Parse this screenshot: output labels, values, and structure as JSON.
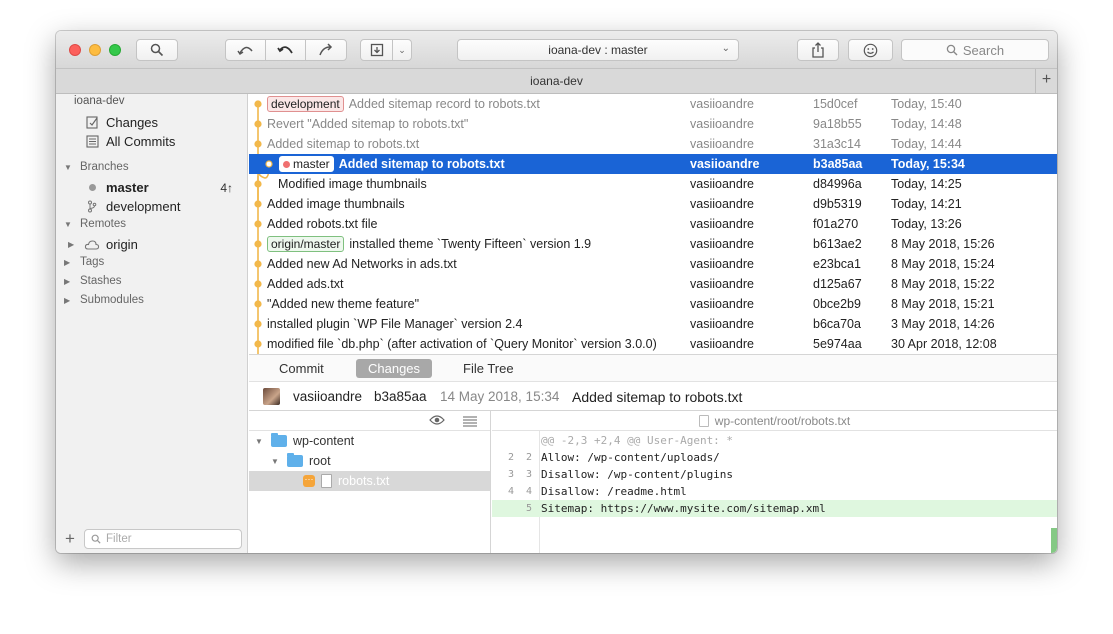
{
  "titlebar": {
    "repo_branch": "ioana-dev :  master",
    "search_placeholder": "Search"
  },
  "tabbar": {
    "title": "ioana-dev"
  },
  "sidebar": {
    "repo_name": "ioana-dev",
    "workspace": [
      {
        "label": "Changes",
        "icon": "changes-icon"
      },
      {
        "label": "All Commits",
        "icon": "all-commits-icon"
      }
    ],
    "branches_header": "Branches",
    "branches": [
      {
        "label": "master",
        "count": "4↑",
        "current": true
      },
      {
        "label": "development",
        "count": "",
        "current": false
      }
    ],
    "remotes_header": "Remotes",
    "remotes": [
      {
        "label": "origin"
      }
    ],
    "tags_header": "Tags",
    "stashes_header": "Stashes",
    "submodules_header": "Submodules",
    "filter_placeholder": "Filter"
  },
  "commits": [
    {
      "tag": "development",
      "tag_style": "red",
      "message": "Added sitemap record to robots.txt",
      "author": "vasiioandre",
      "hash": "15d0cef",
      "date": "Today, 15:40",
      "dim": true
    },
    {
      "tag": "",
      "message": "Revert \"Added sitemap to robots.txt\"",
      "author": "vasiioandre",
      "hash": "9a18b55",
      "date": "Today, 14:48",
      "dim": true
    },
    {
      "tag": "",
      "message": "Added sitemap to robots.txt",
      "author": "vasiioandre",
      "hash": "31a3c14",
      "date": "Today, 14:44",
      "dim": true
    },
    {
      "tag": "master",
      "tag_style": "sel",
      "message": "Added sitemap to robots.txt",
      "author": "vasiioandre",
      "hash": "b3a85aa",
      "date": "Today, 15:34",
      "selected": true
    },
    {
      "tag": "",
      "message": "Modified image thumbnails",
      "author": "vasiioandre",
      "hash": "d84996a",
      "date": "Today, 14:25",
      "indent": true
    },
    {
      "tag": "",
      "message": "Added image thumbnails",
      "author": "vasiioandre",
      "hash": "d9b5319",
      "date": "Today, 14:21"
    },
    {
      "tag": "",
      "message": "Added robots.txt file",
      "author": "vasiioandre",
      "hash": "f01a270",
      "date": "Today, 13:26"
    },
    {
      "tag": "origin/master",
      "tag_style": "green",
      "message": "installed theme `Twenty Fifteen` version 1.9",
      "author": "vasiioandre",
      "hash": "b613ae2",
      "date": "8 May 2018, 15:26"
    },
    {
      "tag": "",
      "message": "Added new Ad Networks in ads.txt",
      "author": "vasiioandre",
      "hash": "e23bca1",
      "date": "8 May 2018, 15:24"
    },
    {
      "tag": "",
      "message": "Added ads.txt",
      "author": "vasiioandre",
      "hash": "d125a67",
      "date": "8 May 2018, 15:22"
    },
    {
      "tag": "",
      "message": "\"Added new theme feature\"",
      "author": "vasiioandre",
      "hash": "0bce2b9",
      "date": "8 May 2018, 15:21"
    },
    {
      "tag": "",
      "message": "installed plugin `WP File Manager` version 2.4",
      "author": "vasiioandre",
      "hash": "b6ca70a",
      "date": "3 May 2018, 14:26"
    },
    {
      "tag": "",
      "message": "modified file `db.php` (after activation of `Query Monitor` version 3.0.0)",
      "author": "vasiioandre",
      "hash": "5e974aa",
      "date": "30 Apr 2018, 12:08"
    }
  ],
  "detail_tabs": [
    {
      "label": "Commit",
      "active": false
    },
    {
      "label": "Changes",
      "active": true
    },
    {
      "label": "File Tree",
      "active": false
    }
  ],
  "commit_info": {
    "author": "vasiioandre",
    "hash": "b3a85aa",
    "date": "14 May 2018, 15:34",
    "message": "Added sitemap to robots.txt"
  },
  "file_tree": [
    {
      "label": "wp-content",
      "type": "folder",
      "level": 0
    },
    {
      "label": "root",
      "type": "folder",
      "level": 1
    },
    {
      "label": "robots.txt",
      "type": "file",
      "level": 2,
      "selected": true,
      "badge": "···"
    }
  ],
  "diff": {
    "path": "wp-content/root/robots.txt",
    "lines": [
      {
        "old": "",
        "new": "",
        "text": "@@ -2,3 +2,4 @@ User-Agent: *",
        "kind": "hunk"
      },
      {
        "old": "2",
        "new": "2",
        "text": "Allow: /wp-content/uploads/",
        "kind": "ctx"
      },
      {
        "old": "3",
        "new": "3",
        "text": "Disallow: /wp-content/plugins",
        "kind": "ctx"
      },
      {
        "old": "4",
        "new": "4",
        "text": "Disallow: /readme.html",
        "kind": "ctx"
      },
      {
        "old": "",
        "new": "5",
        "text": "Sitemap: https://www.mysite.com/sitemap.xml",
        "kind": "add"
      }
    ]
  },
  "colors": {
    "selection": "#1a64d6",
    "graph": "#f2b84b",
    "added": "#dff7df"
  }
}
